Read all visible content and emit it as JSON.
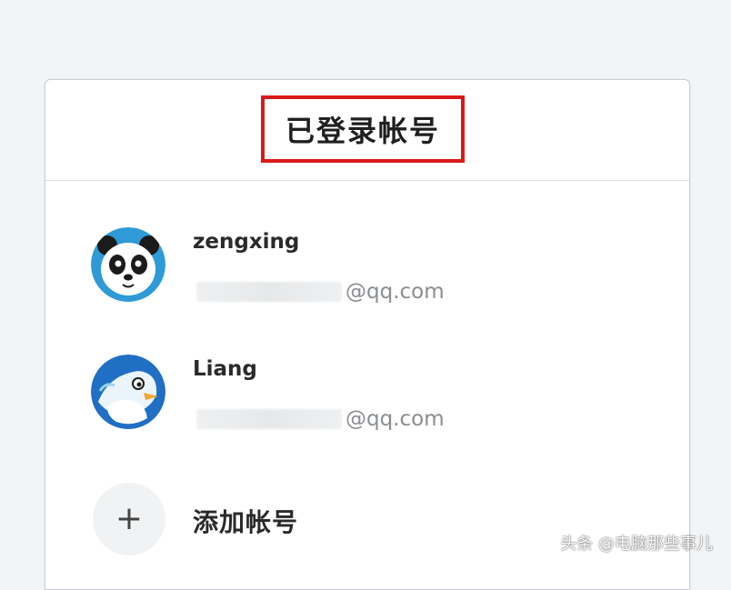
{
  "panel": {
    "title": "已登录帐号"
  },
  "accounts": [
    {
      "name": "zengxing",
      "email_domain": "@qq.com",
      "avatar_icon": "panda-avatar-icon"
    },
    {
      "name": "Liang",
      "email_domain": "@qq.com",
      "avatar_icon": "penguin-avatar-icon"
    }
  ],
  "add_account": {
    "icon": "plus-icon",
    "plus_glyph": "+",
    "label": "添加帐号"
  },
  "watermark": "头条 @电脑那些事儿",
  "colors": {
    "highlight_border": "#d91a1a",
    "avatar_blue": "#2f9ad8"
  }
}
